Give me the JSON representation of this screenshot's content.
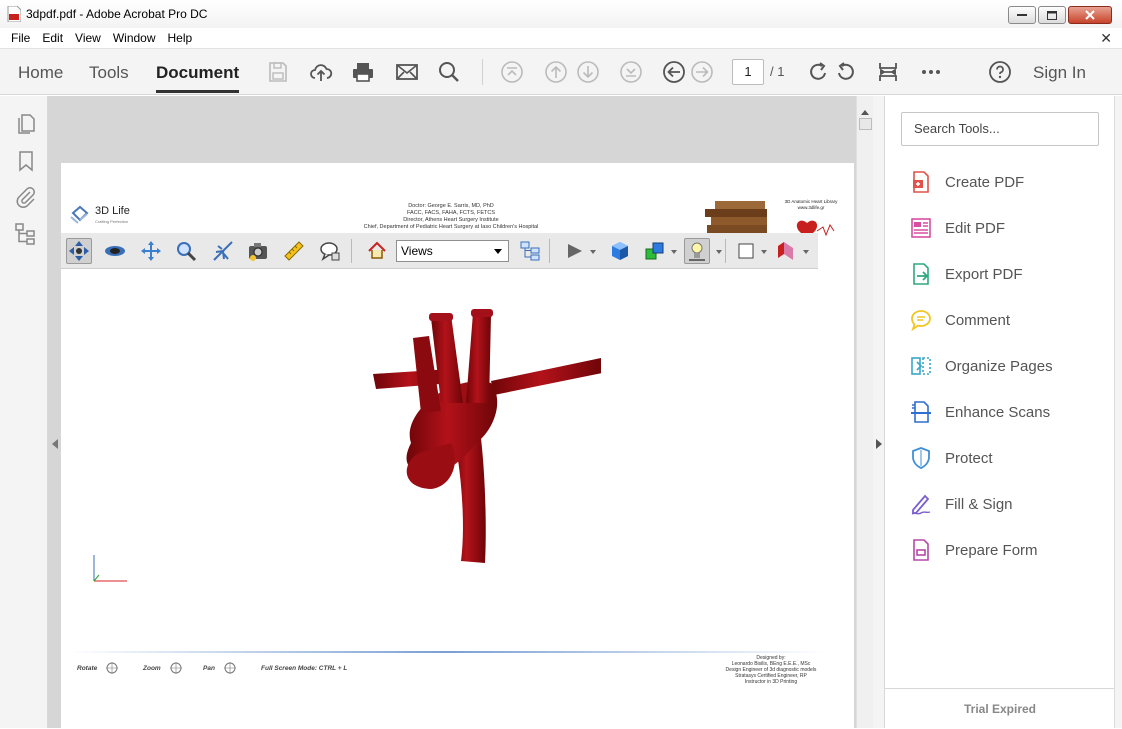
{
  "window": {
    "title": "3dpdf.pdf - Adobe Acrobat Pro DC"
  },
  "menu": [
    "File",
    "Edit",
    "View",
    "Window",
    "Help"
  ],
  "toolbar": {
    "tabs": [
      "Home",
      "Tools",
      "Document"
    ],
    "active_tab": "Document",
    "page_current": "1",
    "page_total": "/ 1",
    "sign_in": "Sign In"
  },
  "document": {
    "logo_name": "3D Life",
    "logo_tagline": "Crafting Perfection",
    "doctor_lines": [
      "Doctor: George E. Sarris, MD, PhD",
      "FACC, FACS, FAHA, FCTS, FETCS",
      "Director, Athens Heart Surgery Institute",
      "Chief, Department of Pediatric Heart Surgery at Iaso Children's Hospital"
    ],
    "library_lines": [
      "3D Anatomic Heart Library",
      "www.3dlife.gr"
    ],
    "views_label": "Views",
    "footer_controls": [
      "Rotate",
      "Zoom",
      "Pan",
      "Full Screen Mode:  CTRL + L"
    ],
    "designer_lines": [
      "Designed by:",
      "Leonardo Bisilis, BEng E.E.E., MSc",
      "Design Engineer of 3d diagnostic models",
      "Stratasys Certified Engineer, RP",
      "Instructor in 3D Printing"
    ]
  },
  "right_pane": {
    "search_placeholder": "Search Tools...",
    "tools": [
      {
        "label": "Create PDF",
        "icon": "create-pdf-icon",
        "color": "#e0524a"
      },
      {
        "label": "Edit PDF",
        "icon": "edit-pdf-icon",
        "color": "#d94fa0"
      },
      {
        "label": "Export PDF",
        "icon": "export-pdf-icon",
        "color": "#2ea87e"
      },
      {
        "label": "Comment",
        "icon": "comment-icon",
        "color": "#f2c523"
      },
      {
        "label": "Organize Pages",
        "icon": "organize-pages-icon",
        "color": "#3aa6c9"
      },
      {
        "label": "Enhance Scans",
        "icon": "enhance-scans-icon",
        "color": "#2f6fd1"
      },
      {
        "label": "Protect",
        "icon": "protect-icon",
        "color": "#3f8fd8"
      },
      {
        "label": "Fill & Sign",
        "icon": "fill-sign-icon",
        "color": "#7a5fd0"
      },
      {
        "label": "Prepare Form",
        "icon": "prepare-form-icon",
        "color": "#b54aa8"
      }
    ],
    "trial_status": "Trial Expired"
  }
}
